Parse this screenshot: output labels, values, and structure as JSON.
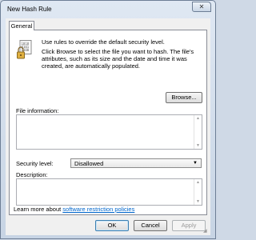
{
  "window": {
    "title": "New Hash Rule",
    "close_glyph": "✕"
  },
  "tabs": [
    {
      "label": "General"
    }
  ],
  "intro": {
    "line1": "Use rules to override the default security level.",
    "line2": "Click Browse to select the file you want to hash. The file's attributes, such as its size and the date and time it was created, are automatically populated."
  },
  "browse_button": "Browse...",
  "file_info": {
    "label": "File information:",
    "value": ""
  },
  "security_level": {
    "label": "Security level:",
    "selected": "Disallowed"
  },
  "description": {
    "label": "Description:",
    "value": ""
  },
  "learn_more": {
    "prefix": "Learn more about ",
    "link": "software restriction policies"
  },
  "footer": {
    "ok": "OK",
    "cancel": "Cancel",
    "apply": "Apply"
  },
  "icons": {
    "rule_icon": "binary-file-lock-icon",
    "close": "close-icon",
    "dropdown": "chevron-down-icon"
  }
}
